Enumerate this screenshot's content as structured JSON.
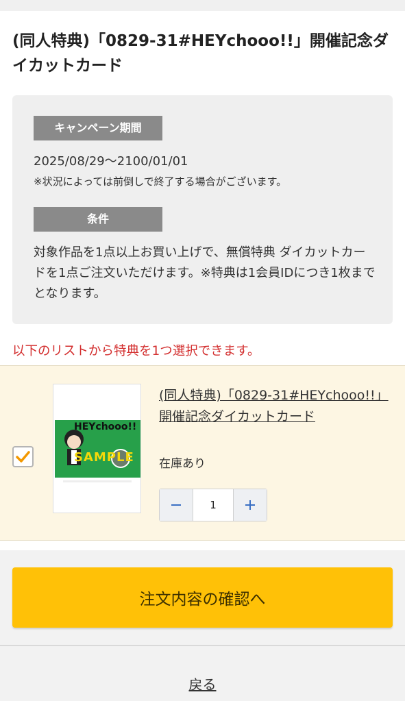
{
  "header": {
    "title": "(同人特典)「0829-31#HEYchooo!!」開催記念ダイカットカード"
  },
  "campaign": {
    "period_label": "キャンペーン期間",
    "period_value": "2025/08/29〜2100/01/01",
    "period_note": "※状況によっては前倒しで終了する場合がございます。",
    "condition_label": "条件",
    "condition_text": "対象作品を1点以上お買い上げで、無償特典 ダイカットカードを1点ご注文いただけます。※特典は1会員IDにつき1枚までとなります。"
  },
  "selection_note": "以下のリストから特典を1つ選択できます。",
  "item": {
    "checked": true,
    "thumb_title": "HEYchooo!!",
    "thumb_watermark": "SAMPLE",
    "name": "(同人特典)「0829-31#HEYchooo!!」開催記念ダイカットカード",
    "stock": "在庫あり",
    "quantity": "1",
    "minus_icon": "minus-icon",
    "plus_icon": "plus-icon"
  },
  "colors": {
    "accent": "#ffc107",
    "warning_text": "#d32f2f",
    "checkbox_check": "#f39800",
    "item_bg": "#fdf6e3"
  },
  "actions": {
    "confirm_label": "注文内容の確認へ",
    "back_label": "戻る"
  }
}
